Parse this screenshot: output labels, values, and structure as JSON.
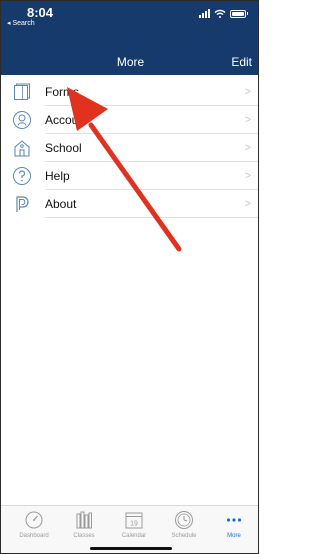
{
  "status": {
    "time": "8:04",
    "back_label": "◂ Search"
  },
  "navbar": {
    "title": "More",
    "edit_label": "Edit"
  },
  "menu": [
    {
      "label": "Forms",
      "icon": "forms-icon"
    },
    {
      "label": "Accou",
      "icon": "account-icon"
    },
    {
      "label": "School",
      "icon": "school-icon"
    },
    {
      "label": "Help",
      "icon": "help-icon"
    },
    {
      "label": "About",
      "icon": "about-icon"
    }
  ],
  "chevron": ">",
  "tabs": [
    {
      "label": "Dashboard",
      "icon": "dashboard-icon",
      "active": false
    },
    {
      "label": "Classes",
      "icon": "classes-icon",
      "active": false
    },
    {
      "label": "Calendar",
      "icon": "calendar-icon",
      "active": false,
      "day": "19"
    },
    {
      "label": "Schedule",
      "icon": "schedule-icon",
      "active": false
    },
    {
      "label": "More",
      "icon": "more-icon",
      "active": true
    }
  ],
  "colors": {
    "nav_bg": "#163a6b",
    "icon_blue": "#5a86b8",
    "accent": "#1a6fd1",
    "annotation_arrow": "#e0321e"
  }
}
